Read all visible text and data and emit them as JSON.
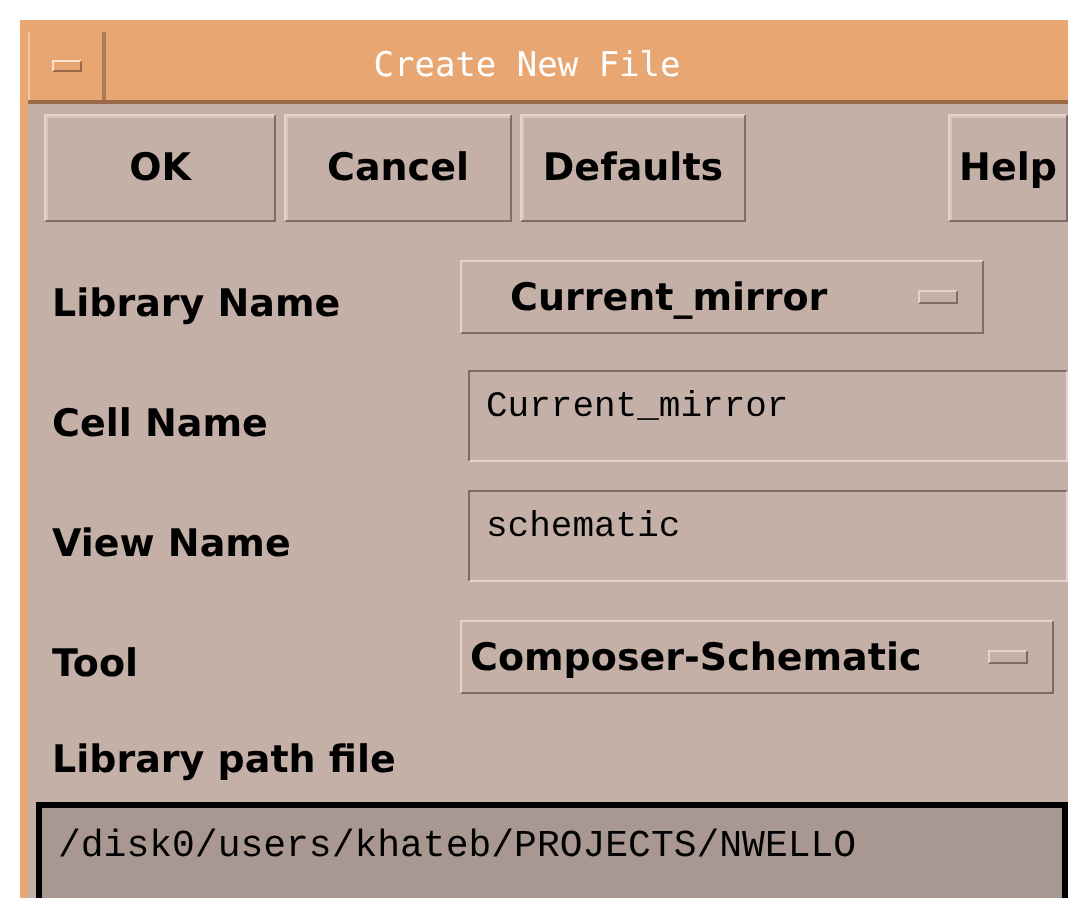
{
  "window": {
    "title": "Create New File"
  },
  "buttons": [
    {
      "label": "OK"
    },
    {
      "label": "Cancel"
    },
    {
      "label": "Defaults"
    },
    {
      "label": "Help"
    }
  ],
  "fields": [
    {
      "kind": "option",
      "label": "Library Name",
      "value": "Current_mirror"
    },
    {
      "kind": "text",
      "label": "Cell Name",
      "value": "Current_mirror"
    },
    {
      "kind": "text",
      "label": "View Name",
      "value": "schematic"
    },
    {
      "kind": "option",
      "label": "Tool",
      "value": "Composer-Schematic"
    }
  ],
  "library_path": {
    "label": "Library path file",
    "value": "/disk0/users/khateb/PROJECTS/NWELLO"
  }
}
